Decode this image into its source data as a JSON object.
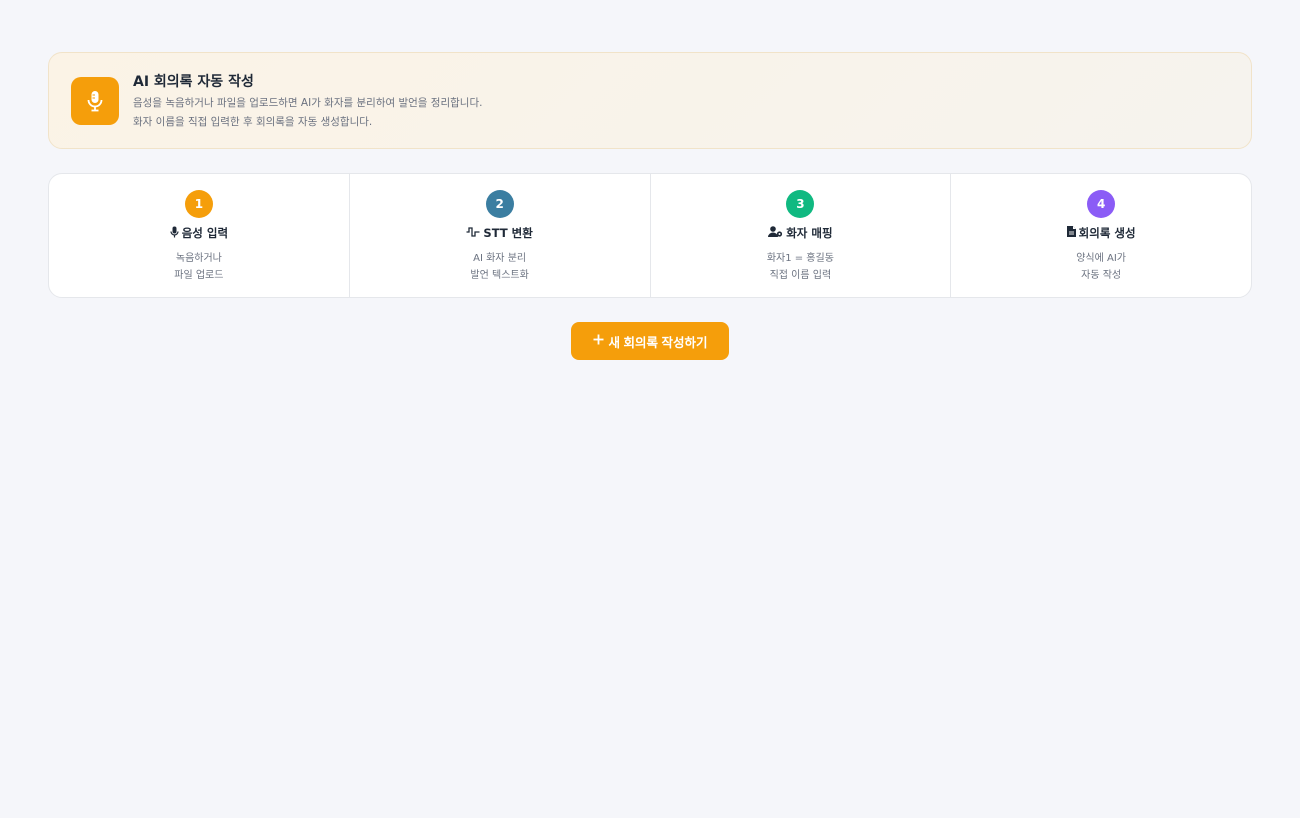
{
  "banner": {
    "icon": "microphone-icon",
    "title": "AI 회의록 자동 작성",
    "desc_line1": "음성을 녹음하거나 파일을 업로드하면 AI가 화자를 분리하여 발언을 정리합니다.",
    "desc_line2": "화자 이름을 직접 입력한 후 회의록을 자동 생성합니다."
  },
  "steps": [
    {
      "num": "1",
      "color": "#f59e0b",
      "icon": "microphone-icon",
      "title": "음성 입력",
      "desc1": "녹음하거나",
      "desc2": "파일 업로드"
    },
    {
      "num": "2",
      "color": "#3b7ea1",
      "icon": "waveform-icon",
      "title": "STT 변환",
      "desc1": "AI 화자 분리",
      "desc2": "발언 텍스트화"
    },
    {
      "num": "3",
      "color": "#10b981",
      "icon": "user-tag-icon",
      "title": "화자 매핑",
      "desc1": "화자1 = 홍길동",
      "desc2": "직접 이름 입력"
    },
    {
      "num": "4",
      "color": "#8b5cf6",
      "icon": "document-icon",
      "title": "회의록 생성",
      "desc1": "양식에 AI가",
      "desc2": "자동 작성"
    }
  ],
  "actions": {
    "new_label": "새 회의록 작성하기",
    "new_icon": "plus-icon",
    "accent": "#f59e0b"
  }
}
